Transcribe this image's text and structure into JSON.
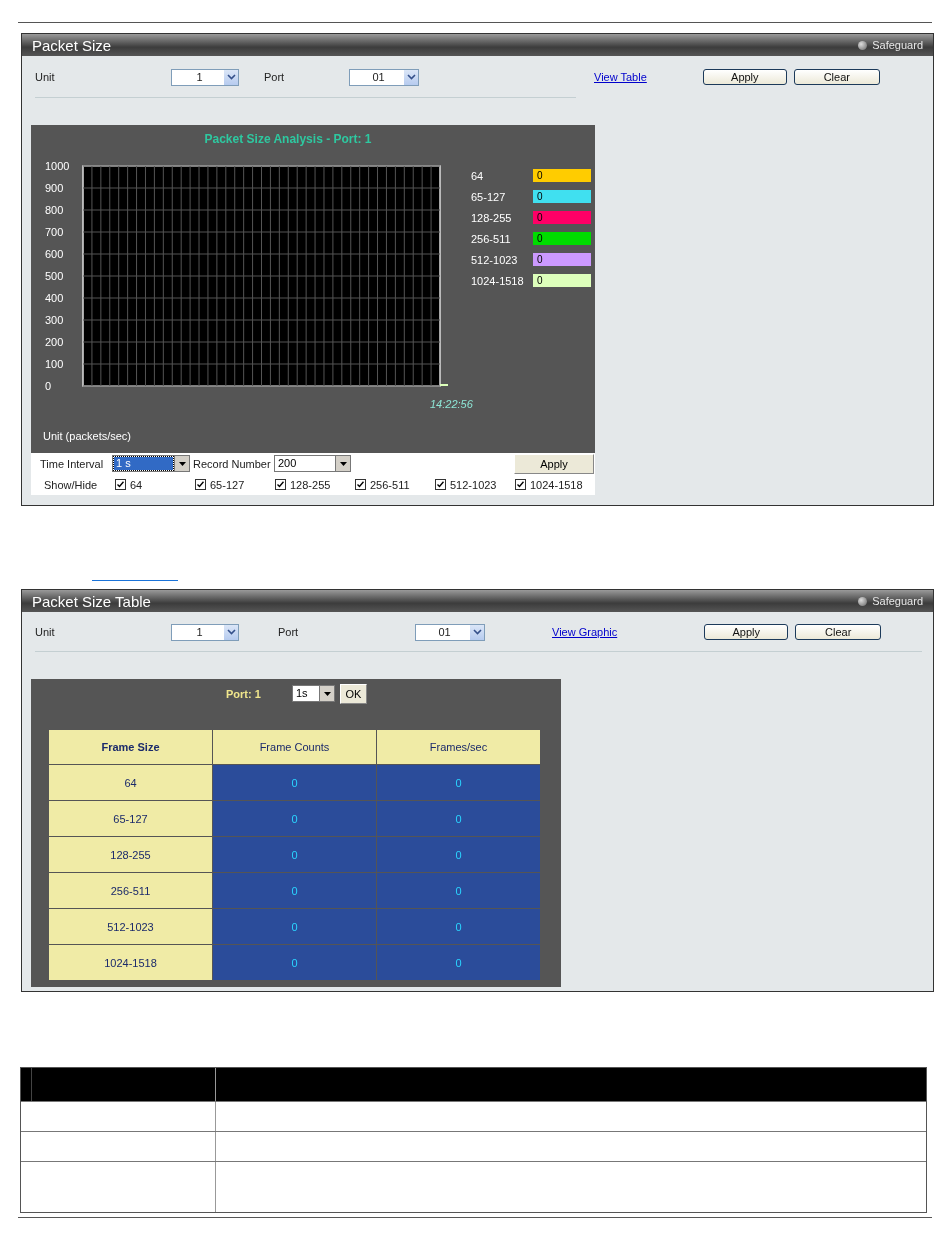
{
  "graph_panel": {
    "title": "Packet Size",
    "safeguard": "Safeguard",
    "unit": {
      "label": "Unit",
      "value": "1"
    },
    "port": {
      "label": "Port",
      "value": "01"
    },
    "link": "View Table",
    "buttons": [
      "Apply",
      "Clear"
    ],
    "chart": {
      "title": "Packet Size Analysis - Port: 1",
      "unit_label": "Unit (packets/sec)",
      "y_axis_labels": [
        "1000",
        "900",
        "800",
        "700",
        "600",
        "500",
        "400",
        "300",
        "200",
        "100",
        "0"
      ],
      "time_label": "14:22:56",
      "legend": [
        {
          "label": "64",
          "reading": "0",
          "color": "#ffcc00"
        },
        {
          "label": "65-127",
          "reading": "0",
          "color": "#40e0f0"
        },
        {
          "label": "128-255",
          "reading": "0",
          "color": "#ff0066"
        },
        {
          "label": "256-511",
          "reading": "0",
          "color": "#00dd00"
        },
        {
          "label": "512-1023",
          "reading": "0",
          "color": "#cc99ff"
        },
        {
          "label": "1024-1518",
          "reading": "0",
          "color": "#ddffbb"
        }
      ]
    },
    "time_interval": {
      "label": "Time Interval",
      "value": "1 s"
    },
    "record_number": {
      "label": "Record Number",
      "value": "200"
    },
    "apply": "Apply",
    "show_hide": {
      "label": "Show/Hide",
      "items": [
        {
          "label": "64",
          "checked": true
        },
        {
          "label": "65-127",
          "checked": true
        },
        {
          "label": "128-255",
          "checked": true
        },
        {
          "label": "256-511",
          "checked": true
        },
        {
          "label": "512-1023",
          "checked": true
        },
        {
          "label": "1024-1518",
          "checked": true
        }
      ]
    }
  },
  "table_panel": {
    "title": "Packet Size Table",
    "safeguard": "Safeguard",
    "unit": {
      "label": "Unit",
      "value": "1"
    },
    "port": {
      "label": "Port",
      "value": "01"
    },
    "link": "View Graphic",
    "buttons": [
      "Apply",
      "Clear"
    ],
    "port_label": "Port: 1",
    "interval": "1s",
    "ok": "OK",
    "table": {
      "columns": [
        "Frame Size",
        "Frame Counts",
        "Frames/sec"
      ],
      "rows": [
        [
          "64",
          "0",
          "0"
        ],
        [
          "65-127",
          "0",
          "0"
        ],
        [
          "128-255",
          "0",
          "0"
        ],
        [
          "256-511",
          "0",
          "0"
        ],
        [
          "512-1023",
          "0",
          "0"
        ],
        [
          "1024-1518",
          "0",
          "0"
        ]
      ]
    }
  },
  "description_table": {
    "rows": [
      {
        "kind": "single"
      },
      {
        "kind": "single"
      },
      {
        "kind": "tall"
      }
    ]
  }
}
